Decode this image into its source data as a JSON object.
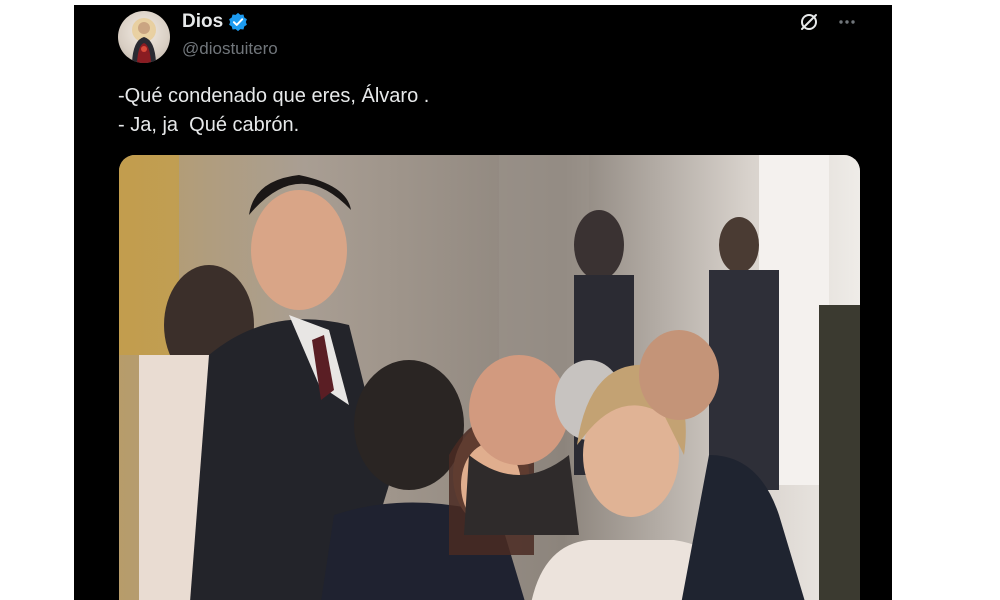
{
  "tweet": {
    "author": {
      "display_name": "Dios",
      "handle": "@diostuitero",
      "verified": true,
      "avatar_icon": "avatar-icon"
    },
    "actions": {
      "grok_icon": "grok-icon",
      "more_icon": "more-icon"
    },
    "text_lines": [
      "-Qué condenado que eres, Álvaro .",
      "- Ja, ja  Qué cabrón."
    ],
    "media": {
      "kind": "photo",
      "icon": "photo-icon"
    }
  },
  "colors": {
    "background": "#000000",
    "text_primary": "#e7e9ea",
    "text_secondary": "#71767b",
    "verified_blue": "#1d9bf0"
  }
}
